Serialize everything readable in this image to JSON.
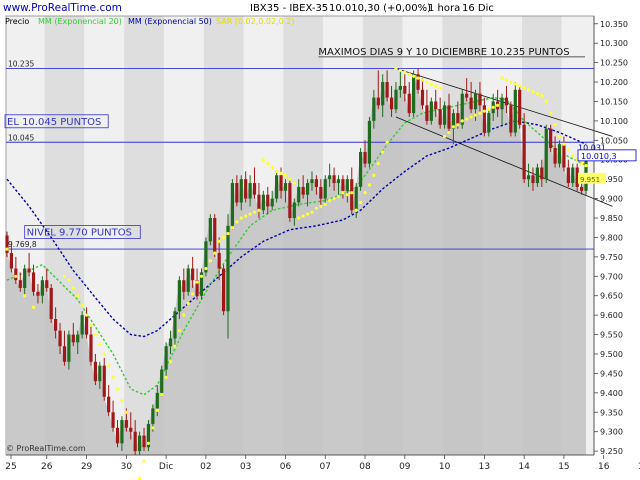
{
  "header": {
    "site": "www.ProRealTime.com",
    "instrument": "IBX35 - IBEX-35",
    "last_value": "10.010,30 (+0,00%)",
    "timeframe": "1 hora",
    "date": "16 Dic"
  },
  "legend": {
    "price": "Precio",
    "ema20": "MM (Exponencial 20)",
    "ema50": "MM (Exponencial 50)",
    "sar": "SAR (0.02,0.02,0.2)"
  },
  "footer": {
    "copyright": "© ProRealTime.com"
  },
  "colors": {
    "up": "#1e6b1e",
    "down": "#a01818",
    "ema20": "#33cc33",
    "ema50": "#0000aa",
    "sar": "#ffff33",
    "hline": "#3333cc",
    "band_light": "#f0f0f0",
    "band_dark": "#dedede",
    "area": "#c2c2c2"
  },
  "chart_data": {
    "type": "candlestick",
    "title": "IBX35 - IBEX-35",
    "ylim": [
      9240,
      10370
    ],
    "ymin_tick": 9250,
    "ymax_tick": 10350,
    "ytick_step": 50,
    "x_labels": [
      "25",
      "26",
      "29",
      "30",
      "Dic",
      "02",
      "03",
      "06",
      "07",
      "08",
      "09",
      "10",
      "13",
      "14",
      "15",
      "16",
      "17"
    ],
    "bars_per_day": 9,
    "candles": [
      [
        9805,
        9815,
        9750,
        9760
      ],
      [
        9760,
        9790,
        9710,
        9720
      ],
      [
        9720,
        9750,
        9680,
        9690
      ],
      [
        9690,
        9710,
        9660,
        9670
      ],
      [
        9670,
        9730,
        9650,
        9720
      ],
      [
        9720,
        9760,
        9700,
        9710
      ],
      [
        9710,
        9730,
        9650,
        9660
      ],
      [
        9660,
        9680,
        9630,
        9650
      ],
      [
        9650,
        9700,
        9630,
        9690
      ],
      [
        9690,
        9720,
        9660,
        9670
      ],
      [
        9670,
        9680,
        9580,
        9590
      ],
      [
        9590,
        9620,
        9540,
        9560
      ],
      [
        9560,
        9580,
        9500,
        9520
      ],
      [
        9520,
        9560,
        9470,
        9480
      ],
      [
        9480,
        9560,
        9460,
        9550
      ],
      [
        9550,
        9580,
        9520,
        9530
      ],
      [
        9530,
        9560,
        9500,
        9550
      ],
      [
        9550,
        9610,
        9540,
        9600
      ],
      [
        9600,
        9620,
        9540,
        9550
      ],
      [
        9550,
        9570,
        9470,
        9480
      ],
      [
        9480,
        9500,
        9420,
        9430
      ],
      [
        9430,
        9480,
        9410,
        9470
      ],
      [
        9470,
        9490,
        9380,
        9390
      ],
      [
        9390,
        9420,
        9340,
        9350
      ],
      [
        9350,
        9380,
        9300,
        9310
      ],
      [
        9310,
        9330,
        9260,
        9270
      ],
      [
        9270,
        9340,
        9250,
        9330
      ],
      [
        9330,
        9360,
        9300,
        9310
      ],
      [
        9310,
        9350,
        9280,
        9300
      ],
      [
        9300,
        9330,
        9240,
        9250
      ],
      [
        9250,
        9300,
        9240,
        9290
      ],
      [
        9290,
        9310,
        9250,
        9260
      ],
      [
        9260,
        9330,
        9250,
        9320
      ],
      [
        9320,
        9370,
        9300,
        9360
      ],
      [
        9360,
        9420,
        9340,
        9400
      ],
      [
        9400,
        9470,
        9390,
        9460
      ],
      [
        9460,
        9530,
        9440,
        9520
      ],
      [
        9520,
        9560,
        9500,
        9540
      ],
      [
        9540,
        9620,
        9520,
        9610
      ],
      [
        9610,
        9700,
        9590,
        9690
      ],
      [
        9690,
        9720,
        9640,
        9660
      ],
      [
        9660,
        9730,
        9650,
        9720
      ],
      [
        9720,
        9750,
        9670,
        9690
      ],
      [
        9690,
        9720,
        9640,
        9650
      ],
      [
        9650,
        9720,
        9640,
        9710
      ],
      [
        9710,
        9800,
        9700,
        9790
      ],
      [
        9790,
        9860,
        9780,
        9850
      ],
      [
        9850,
        9860,
        9750,
        9760
      ],
      [
        9760,
        9800,
        9690,
        9720
      ],
      [
        9720,
        9730,
        9600,
        9610
      ],
      [
        9610,
        9860,
        9540,
        9830
      ],
      [
        9830,
        9950,
        9820,
        9940
      ],
      [
        9940,
        9960,
        9880,
        9890
      ],
      [
        9890,
        9960,
        9870,
        9950
      ],
      [
        9950,
        9970,
        9890,
        9900
      ],
      [
        9900,
        9960,
        9880,
        9940
      ],
      [
        9940,
        9980,
        9900,
        9910
      ],
      [
        9910,
        9940,
        9850,
        9870
      ],
      [
        9870,
        9920,
        9860,
        9910
      ],
      [
        9910,
        9930,
        9860,
        9880
      ],
      [
        9880,
        9920,
        9870,
        9900
      ],
      [
        9900,
        9970,
        9890,
        9960
      ],
      [
        9960,
        9980,
        9900,
        9920
      ],
      [
        9920,
        9950,
        9890,
        9940
      ],
      [
        9940,
        9950,
        9840,
        9850
      ],
      [
        9850,
        9900,
        9830,
        9890
      ],
      [
        9890,
        9950,
        9880,
        9930
      ],
      [
        9930,
        9960,
        9900,
        9910
      ],
      [
        9910,
        9950,
        9880,
        9940
      ],
      [
        9940,
        9970,
        9920,
        9950
      ],
      [
        9950,
        9960,
        9910,
        9930
      ],
      [
        9930,
        9950,
        9880,
        9900
      ],
      [
        9900,
        9960,
        9890,
        9950
      ],
      [
        9950,
        9990,
        9930,
        9960
      ],
      [
        9960,
        9980,
        9920,
        9940
      ],
      [
        9940,
        9960,
        9910,
        9950
      ],
      [
        9950,
        9960,
        9900,
        9920
      ],
      [
        9920,
        9960,
        9890,
        9950
      ],
      [
        9950,
        9980,
        9860,
        9870
      ],
      [
        9870,
        9940,
        9850,
        9930
      ],
      [
        9930,
        10030,
        9920,
        10020
      ],
      [
        10020,
        10050,
        9980,
        9990
      ],
      [
        9990,
        10110,
        9980,
        10100
      ],
      [
        10100,
        10180,
        10080,
        10160
      ],
      [
        10160,
        10230,
        10130,
        10140
      ],
      [
        10140,
        10220,
        10110,
        10200
      ],
      [
        10200,
        10230,
        10150,
        10160
      ],
      [
        10160,
        10190,
        10110,
        10130
      ],
      [
        10130,
        10200,
        10120,
        10180
      ],
      [
        10180,
        10230,
        10160,
        10190
      ],
      [
        10190,
        10220,
        10150,
        10170
      ],
      [
        10170,
        10200,
        10110,
        10120
      ],
      [
        10120,
        10230,
        10110,
        10220
      ],
      [
        10220,
        10235,
        10170,
        10180
      ],
      [
        10180,
        10210,
        10130,
        10140
      ],
      [
        10140,
        10180,
        10090,
        10100
      ],
      [
        10100,
        10160,
        10090,
        10150
      ],
      [
        10150,
        10180,
        10110,
        10130
      ],
      [
        10130,
        10160,
        10080,
        10090
      ],
      [
        10090,
        10150,
        10080,
        10140
      ],
      [
        10140,
        10170,
        10070,
        10080
      ],
      [
        10080,
        10130,
        10040,
        10120
      ],
      [
        10120,
        10150,
        10080,
        10090
      ],
      [
        10090,
        10180,
        10080,
        10170
      ],
      [
        10170,
        10210,
        10150,
        10160
      ],
      [
        10160,
        10200,
        10120,
        10130
      ],
      [
        10130,
        10180,
        10100,
        10170
      ],
      [
        10170,
        10200,
        10120,
        10140
      ],
      [
        10140,
        10160,
        10060,
        10070
      ],
      [
        10070,
        10130,
        10060,
        10120
      ],
      [
        10120,
        10170,
        10100,
        10150
      ],
      [
        10150,
        10180,
        10110,
        10130
      ],
      [
        10130,
        10170,
        10090,
        10160
      ],
      [
        10160,
        10190,
        10120,
        10140
      ],
      [
        10140,
        10150,
        10060,
        10070
      ],
      [
        10070,
        10200,
        10060,
        10180
      ],
      [
        10180,
        10190,
        10080,
        10090
      ],
      [
        10090,
        10120,
        9940,
        9950
      ],
      [
        9950,
        9990,
        9930,
        9960
      ],
      [
        9960,
        9980,
        9920,
        9940
      ],
      [
        9940,
        9990,
        9930,
        9980
      ],
      [
        9980,
        10000,
        9930,
        9950
      ],
      [
        9950,
        10090,
        9940,
        10080
      ],
      [
        10080,
        10090,
        10020,
        10030
      ],
      [
        10030,
        10060,
        9980,
        9990
      ],
      [
        9990,
        10050,
        9980,
        10040
      ],
      [
        10040,
        10060,
        9970,
        9980
      ],
      [
        9980,
        10000,
        9930,
        9940
      ],
      [
        9940,
        9990,
        9930,
        9980
      ],
      [
        9980,
        9990,
        9920,
        9930
      ],
      [
        9930,
        9960,
        9910,
        9920
      ],
      [
        9920,
        10020,
        9910,
        10010
      ]
    ],
    "ema20": [
      [
        0,
        9690
      ],
      [
        8,
        9730
      ],
      [
        16,
        9640
      ],
      [
        24,
        9500
      ],
      [
        28,
        9410
      ],
      [
        31,
        9395
      ],
      [
        34,
        9420
      ],
      [
        40,
        9560
      ],
      [
        45,
        9660
      ],
      [
        50,
        9750
      ],
      [
        55,
        9830
      ],
      [
        60,
        9870
      ],
      [
        66,
        9885
      ],
      [
        72,
        9895
      ],
      [
        76,
        9912
      ],
      [
        79,
        9930
      ],
      [
        82,
        9975
      ],
      [
        86,
        10040
      ],
      [
        90,
        10095
      ],
      [
        94,
        10120
      ],
      [
        98,
        10130
      ],
      [
        102,
        10140
      ],
      [
        106,
        10150
      ],
      [
        110,
        10160
      ],
      [
        113,
        10155
      ],
      [
        117,
        10100
      ],
      [
        121,
        10060
      ],
      [
        125,
        10020
      ],
      [
        131,
        9985
      ]
    ],
    "ema50": [
      [
        0,
        9950
      ],
      [
        5,
        9880
      ],
      [
        10,
        9800
      ],
      [
        15,
        9715
      ],
      [
        20,
        9645
      ],
      [
        24,
        9590
      ],
      [
        28,
        9550
      ],
      [
        31,
        9545
      ],
      [
        34,
        9560
      ],
      [
        38,
        9600
      ],
      [
        43,
        9650
      ],
      [
        48,
        9700
      ],
      [
        53,
        9750
      ],
      [
        58,
        9790
      ],
      [
        64,
        9820
      ],
      [
        70,
        9830
      ],
      [
        76,
        9845
      ],
      [
        80,
        9870
      ],
      [
        85,
        9925
      ],
      [
        90,
        9970
      ],
      [
        95,
        10010
      ],
      [
        100,
        10030
      ],
      [
        105,
        10055
      ],
      [
        110,
        10080
      ],
      [
        115,
        10100
      ],
      [
        120,
        10090
      ],
      [
        125,
        10070
      ],
      [
        131,
        10040
      ]
    ],
    "sar_up": [
      [
        0,
        9770
      ],
      [
        2,
        9700
      ],
      [
        4,
        9650
      ],
      [
        6,
        9620
      ],
      [
        30,
        9180
      ],
      [
        31,
        9225
      ],
      [
        32,
        9270
      ],
      [
        33,
        9310
      ],
      [
        34,
        9355
      ],
      [
        35,
        9395
      ],
      [
        36,
        9440
      ],
      [
        37,
        9480
      ],
      [
        38,
        9520
      ],
      [
        39,
        9560
      ],
      [
        40,
        9600
      ],
      [
        41,
        9630
      ],
      [
        42,
        9655
      ],
      [
        43,
        9685
      ],
      [
        44,
        9700
      ],
      [
        45,
        9720
      ],
      [
        46,
        9740
      ],
      [
        47,
        9760
      ],
      [
        48,
        9790
      ],
      [
        49,
        9800
      ],
      [
        50,
        9810
      ],
      [
        51,
        9825
      ],
      [
        52,
        9840
      ],
      [
        53,
        9850
      ],
      [
        54,
        9855
      ],
      [
        55,
        9860
      ],
      [
        56,
        9865
      ],
      [
        57,
        9870
      ],
      [
        66,
        9850
      ],
      [
        67,
        9855
      ],
      [
        68,
        9860
      ],
      [
        69,
        9865
      ],
      [
        70,
        9875
      ],
      [
        71,
        9880
      ],
      [
        72,
        9885
      ],
      [
        73,
        9895
      ],
      [
        74,
        9900
      ],
      [
        75,
        9905
      ],
      [
        76,
        9915
      ],
      [
        77,
        9910
      ],
      [
        78,
        9915
      ],
      [
        79,
        9870
      ],
      [
        80,
        9890
      ],
      [
        81,
        9915
      ],
      [
        82,
        9935
      ],
      [
        83,
        9960
      ],
      [
        84,
        9990
      ],
      [
        85,
        10020
      ],
      [
        86,
        10045
      ],
      [
        99,
        10060
      ],
      [
        100,
        10070
      ],
      [
        101,
        10085
      ],
      [
        102,
        10090
      ],
      [
        103,
        10100
      ],
      [
        104,
        10105
      ],
      [
        105,
        10110
      ],
      [
        106,
        10115
      ],
      [
        107,
        10120
      ],
      [
        108,
        10125
      ],
      [
        109,
        10130
      ],
      [
        110,
        10135
      ],
      [
        111,
        10140
      ]
    ],
    "sar_down": [
      [
        13,
        9700
      ],
      [
        14,
        9690
      ],
      [
        15,
        9670
      ],
      [
        16,
        9650
      ],
      [
        17,
        9625
      ],
      [
        18,
        9600
      ],
      [
        19,
        9575
      ],
      [
        20,
        9550
      ],
      [
        21,
        9525
      ],
      [
        22,
        9500
      ],
      [
        23,
        9470
      ],
      [
        24,
        9440
      ],
      [
        25,
        9410
      ],
      [
        26,
        9380
      ],
      [
        27,
        9350
      ],
      [
        58,
        10000
      ],
      [
        59,
        9990
      ],
      [
        60,
        9980
      ],
      [
        61,
        9970
      ],
      [
        62,
        9965
      ],
      [
        63,
        9960
      ],
      [
        64,
        9950
      ],
      [
        65,
        9940
      ],
      [
        88,
        10235
      ],
      [
        89,
        10230
      ],
      [
        90,
        10225
      ],
      [
        91,
        10220
      ],
      [
        92,
        10215
      ],
      [
        93,
        10210
      ],
      [
        94,
        10205
      ],
      [
        95,
        10200
      ],
      [
        96,
        10195
      ],
      [
        97,
        10190
      ],
      [
        98,
        10185
      ],
      [
        112,
        10210
      ],
      [
        113,
        10205
      ],
      [
        114,
        10200
      ],
      [
        115,
        10195
      ],
      [
        116,
        10190
      ],
      [
        117,
        10185
      ],
      [
        118,
        10180
      ],
      [
        119,
        10175
      ],
      [
        120,
        10170
      ],
      [
        121,
        10165
      ],
      [
        122,
        10150
      ],
      [
        123,
        10120
      ],
      [
        124,
        10090
      ],
      [
        125,
        10060
      ],
      [
        126,
        10040
      ],
      [
        127,
        10025
      ],
      [
        128,
        10010
      ],
      [
        129,
        10000
      ],
      [
        130,
        9990
      ],
      [
        131,
        9985
      ]
    ],
    "hlines": [
      {
        "value": 10235,
        "label": "10.235"
      },
      {
        "value": 10045,
        "label": "10.045"
      },
      {
        "value": 9770,
        "label": "9.769,8"
      }
    ],
    "trendlines": [
      [
        [
          88,
          10235
        ],
        [
          137,
          10060
        ]
      ],
      [
        [
          88,
          10110
        ],
        [
          137,
          9880
        ]
      ]
    ],
    "annotations": [
      {
        "text": "MAXIMOS DIAS 9 Y 10 DICIEMBRE 10.235 PUNTOS",
        "x": 70,
        "y": 10270,
        "boxed": false,
        "underline": true
      },
      {
        "text": "EL 10.045 PUNTOS",
        "x": 0,
        "y": 10090,
        "boxed": true,
        "underline": false
      },
      {
        "text": "NIVEL 9.770 PUNTOS",
        "x": 4,
        "y": 9805,
        "boxed": true,
        "underline": false
      }
    ],
    "price_labels": [
      {
        "text": "10.031",
        "value": 10031,
        "style": "plain"
      },
      {
        "text": "10.010,3",
        "value": 10010,
        "style": "box"
      },
      {
        "text": "9.951",
        "value": 9951,
        "style": "yellow"
      }
    ]
  }
}
